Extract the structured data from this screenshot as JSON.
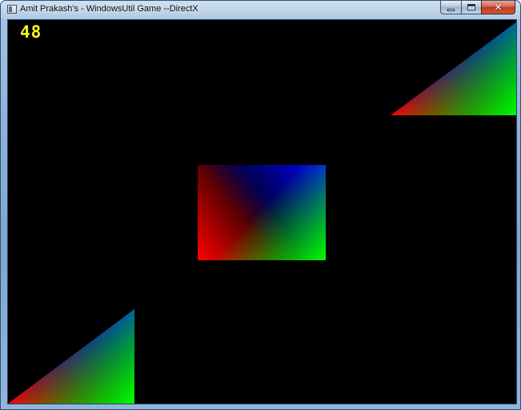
{
  "window": {
    "title": "Amit Prakash's - WindowsUtil Game --DirectX",
    "icon": "app-window-icon",
    "caption_buttons": [
      {
        "name": "minimize",
        "glyph": "minimize-icon"
      },
      {
        "name": "maximize",
        "glyph": "maximize-icon"
      },
      {
        "name": "close",
        "glyph": "close-icon",
        "label": "✕"
      }
    ]
  },
  "game": {
    "fps": "48",
    "background": "#000000",
    "fps_color": "#f7f321",
    "vertex_colors": {
      "red": "#ff0000",
      "green": "#00ff00",
      "blue": "#0000ff",
      "black": "#000000"
    },
    "shapes": [
      {
        "name": "top-right-triangle",
        "type": "triangle"
      },
      {
        "name": "center-quad",
        "type": "quad"
      },
      {
        "name": "bottom-left-triangle",
        "type": "triangle"
      }
    ]
  }
}
